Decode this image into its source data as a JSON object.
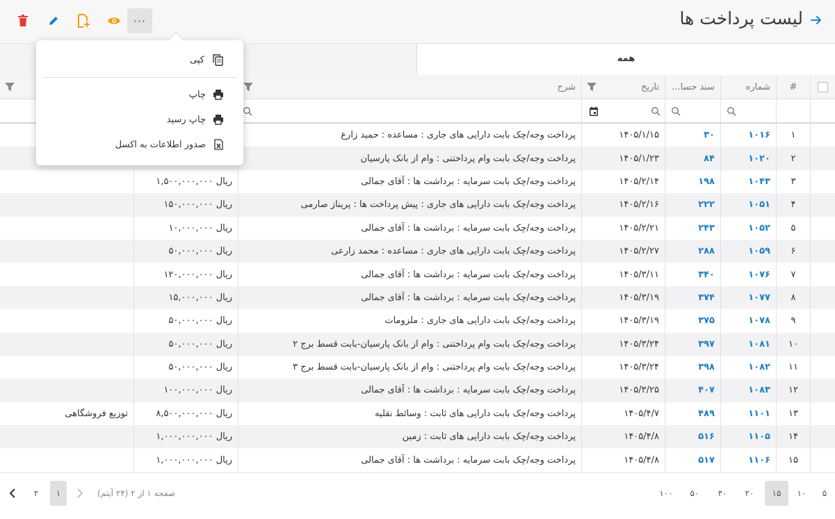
{
  "header": {
    "title": "لیست پرداخت ها",
    "more_label": "···"
  },
  "tabs": {
    "all_label": "همه"
  },
  "columns": {
    "index": "#",
    "number": "شماره",
    "doc": "سند حسا...",
    "date": "تاریخ",
    "desc": "شرح"
  },
  "rows": [
    {
      "index": "۱",
      "number": "۱۰۱۶",
      "doc": "۳۰",
      "date": "۱۴۰۵/۱/۱۵",
      "desc": "پرداخت وجه/چک بابت دارایی های جاری : مساعده : حمید زارع",
      "amount": "",
      "extra": ""
    },
    {
      "index": "۲",
      "number": "۱۰۲۰",
      "doc": "۸۴",
      "date": "۱۴۰۵/۱/۲۳",
      "desc": "پرداخت وجه/چک بابت وام پرداختنی : وام از بانک پارسیان",
      "amount": "",
      "extra": ""
    },
    {
      "index": "۳",
      "number": "۱۰۴۳",
      "doc": "۱۹۸",
      "date": "۱۴۰۵/۲/۱۴",
      "desc": "پرداخت وجه/چک بابت سرمایه : برداشت ها : آقای جمالی",
      "amount": "ریال ۱,۵۰۰,۰۰۰,۰۰۰",
      "extra": ""
    },
    {
      "index": "۴",
      "number": "۱۰۵۱",
      "doc": "۲۲۲",
      "date": "۱۴۰۵/۲/۱۶",
      "desc": "پرداخت وجه/چک بابت دارایی های جاری : پیش پرداخت ها : پریناز صارمی",
      "amount": "ریال ۱۵۰,۰۰۰,۰۰۰",
      "extra": ""
    },
    {
      "index": "۵",
      "number": "۱۰۵۲",
      "doc": "۲۴۳",
      "date": "۱۴۰۵/۲/۲۱",
      "desc": "پرداخت وجه/چک بابت سرمایه : برداشت ها : آقای جمالی",
      "amount": "ریال ۱۰,۰۰۰,۰۰۰",
      "extra": ""
    },
    {
      "index": "۶",
      "number": "۱۰۵۹",
      "doc": "۲۸۸",
      "date": "۱۴۰۵/۲/۲۷",
      "desc": "پرداخت وجه/چک بابت دارایی های جاری : مساعده : محمد زارعی",
      "amount": "ریال ۵۰,۰۰۰,۰۰۰",
      "extra": ""
    },
    {
      "index": "۷",
      "number": "۱۰۷۶",
      "doc": "۳۴۰",
      "date": "۱۴۰۵/۳/۱۱",
      "desc": "پرداخت وجه/چک بابت سرمایه : برداشت ها : آقای جمالی",
      "amount": "ریال ۱۲۰,۰۰۰,۰۰۰",
      "extra": ""
    },
    {
      "index": "۸",
      "number": "۱۰۷۷",
      "doc": "۳۷۴",
      "date": "۱۴۰۵/۳/۱۹",
      "desc": "پرداخت وجه/چک بابت سرمایه : برداشت ها : آقای جمالی",
      "amount": "ریال ۱۵,۰۰۰,۰۰۰",
      "extra": ""
    },
    {
      "index": "۹",
      "number": "۱۰۷۸",
      "doc": "۳۷۵",
      "date": "۱۴۰۵/۳/۱۹",
      "desc": "پرداخت وجه/چک بابت دارایی های جاری : ملزومات",
      "amount": "ریال ۵۰,۰۰۰,۰۰۰",
      "extra": ""
    },
    {
      "index": "۱۰",
      "number": "۱۰۸۱",
      "doc": "۳۹۷",
      "date": "۱۴۰۵/۳/۲۴",
      "desc": "پرداخت وجه/چک بابت وام پرداختنی : وام از بانک پارسیان-بابت قسط برج ۲",
      "amount": "ریال ۵۰,۰۰۰,۰۰۰",
      "extra": ""
    },
    {
      "index": "۱۱",
      "number": "۱۰۸۲",
      "doc": "۳۹۸",
      "date": "۱۴۰۵/۳/۲۴",
      "desc": "پرداخت وجه/چک بابت وام پرداختنی : وام از بانک پارسیان-بابت قسط برج ۳",
      "amount": "ریال ۵۰,۰۰۰,۰۰۰",
      "extra": ""
    },
    {
      "index": "۱۲",
      "number": "۱۰۸۳",
      "doc": "۴۰۷",
      "date": "۱۴۰۵/۳/۲۵",
      "desc": "پرداخت وجه/چک بابت سرمایه : برداشت ها : آقای جمالی",
      "amount": "ریال ۱۰۰,۰۰۰,۰۰۰",
      "extra": ""
    },
    {
      "index": "۱۳",
      "number": "۱۱۰۱",
      "doc": "۴۸۹",
      "date": "۱۴۰۵/۴/۷",
      "desc": "پرداخت وجه/چک بابت دارایی های ثابت : وسائط نقلیه",
      "amount": "ریال ۸,۵۰۰,۰۰۰,۰۰۰",
      "extra": "توزیع فروشگاهی"
    },
    {
      "index": "۱۴",
      "number": "۱۱۰۵",
      "doc": "۵۱۶",
      "date": "۱۴۰۵/۴/۸",
      "desc": "پرداخت وجه/چک بابت دارایی های ثابت : زمین",
      "amount": "ریال ۱,۰۰۰,۰۰۰,۰۰۰",
      "extra": ""
    },
    {
      "index": "۱۵",
      "number": "۱۱۰۶",
      "doc": "۵۱۷",
      "date": "۱۴۰۵/۴/۸",
      "desc": "پرداخت وجه/چک بابت سرمایه : برداشت ها : آقای جمالی",
      "amount": "ریال ۱,۰۰۰,۰۰۰,۰۰۰",
      "extra": ""
    }
  ],
  "pager": {
    "sizes": [
      "۵",
      "۱۰",
      "۱۵",
      "۲۰",
      "۳۰",
      "۵۰",
      "۱۰۰"
    ],
    "active_size": "۱۵",
    "info": "صفحه ۱ از ۲ (۲۴ آیتم)",
    "pages": [
      "۱",
      "۲"
    ],
    "active_page": "۱"
  },
  "menu": {
    "copy_label": "کپی",
    "print_label": "چاپ",
    "print_receipt_label": "چاپ رسید",
    "export_excel_label": "صدور اطلاعات به اکسل"
  },
  "colors": {
    "accent": "#1e7fc4",
    "delete": "#e53935",
    "add": "#f39c12",
    "eye": "#f39c12",
    "edit": "#1e7fc4"
  }
}
